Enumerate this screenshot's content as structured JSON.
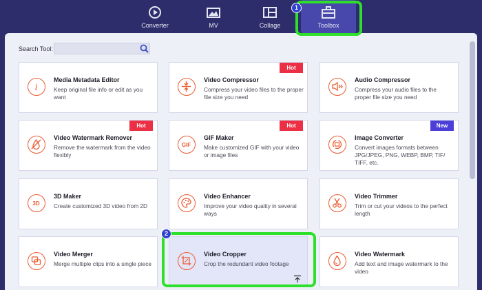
{
  "nav": {
    "tabs": [
      {
        "label": "Converter",
        "icon": "converter-icon"
      },
      {
        "label": "MV",
        "icon": "mv-icon"
      },
      {
        "label": "Collage",
        "icon": "collage-icon"
      },
      {
        "label": "Toolbox",
        "icon": "toolbox-icon",
        "active": true
      }
    ]
  },
  "callouts": [
    "1",
    "2"
  ],
  "search": {
    "label": "Search Tool:",
    "value": "",
    "placeholder": ""
  },
  "tools": [
    {
      "title": "Media Metadata Editor",
      "desc": "Keep original file info or edit as you want",
      "badge": "",
      "icon": "info-icon"
    },
    {
      "title": "Video Compressor",
      "desc": "Compress your video files to the proper file size you need",
      "badge": "Hot",
      "icon": "compress-icon"
    },
    {
      "title": "Audio Compressor",
      "desc": "Compress your audio files to the proper file size you need",
      "badge": "",
      "icon": "audio-compress-icon"
    },
    {
      "title": "Video Watermark Remover",
      "desc": "Remove the watermark from the video flexibly",
      "badge": "Hot",
      "icon": "watermark-remove-icon"
    },
    {
      "title": "GIF Maker",
      "desc": "Make customized GIF with your video or image files",
      "badge": "Hot",
      "icon": "gif-icon"
    },
    {
      "title": "Image Converter",
      "desc": "Convert images formats between JPG/JPEG, PNG, WEBP, BMP, TIF/ TIFF, etc.",
      "badge": "New",
      "icon": "image-convert-icon"
    },
    {
      "title": "3D Maker",
      "desc": "Create customized 3D video from 2D",
      "badge": "",
      "icon": "3d-icon"
    },
    {
      "title": "Video Enhancer",
      "desc": "Improve your video quality in several ways",
      "badge": "",
      "icon": "palette-icon"
    },
    {
      "title": "Video Trimmer",
      "desc": "Trim or cut your videos to the perfect length",
      "badge": "",
      "icon": "scissors-icon"
    },
    {
      "title": "Video Merger",
      "desc": "Merge multiple clips into a single piece",
      "badge": "",
      "icon": "merge-icon"
    },
    {
      "title": "Video Cropper",
      "desc": "Crop the redundant video footage",
      "badge": "",
      "icon": "crop-icon",
      "selected": true
    },
    {
      "title": "Video Watermark",
      "desc": "Add text and image watermark to the video",
      "badge": "",
      "icon": "droplet-icon"
    }
  ],
  "colors": {
    "accent": "#ea5b31",
    "hot": "#ec2f44",
    "new": "#4b3fd8",
    "highlight": "#2ee02b",
    "nav_bg": "#2e2d6b"
  }
}
